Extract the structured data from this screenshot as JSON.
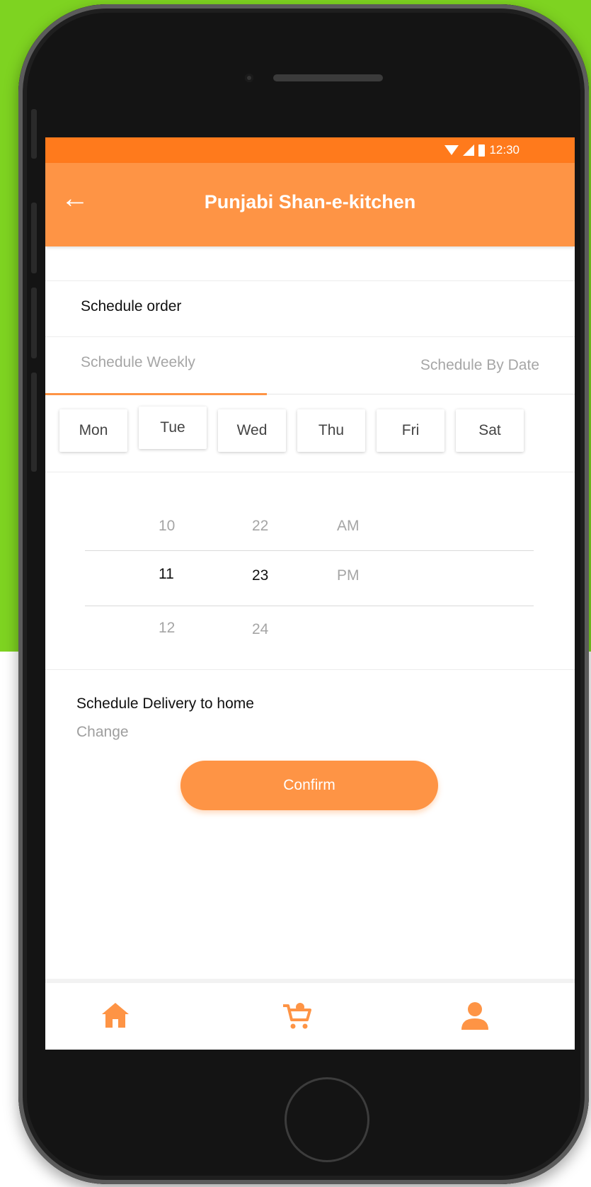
{
  "status_bar": {
    "time": "12:30"
  },
  "app_bar": {
    "title": "Punjabi Shan-e-kitchen",
    "back_icon": "back-arrow-icon"
  },
  "schedule": {
    "label": "Schedule order",
    "tabs": [
      {
        "label": "Schedule Weekly",
        "active": true
      },
      {
        "label": "Schedule By Date",
        "active": false
      }
    ],
    "days": [
      "Mon",
      "Tue",
      "Wed",
      "Thu",
      "Fri",
      "Sat"
    ]
  },
  "time_picker": {
    "hours": [
      "10",
      "11",
      "12"
    ],
    "minutes": [
      "22",
      "23",
      "24"
    ],
    "periods": [
      "AM",
      "PM"
    ]
  },
  "delivery": {
    "text": "Schedule Delivery to home",
    "change_label": "Change",
    "confirm_label": "Confirm"
  },
  "bottom_nav": {
    "icons": [
      "home-icon",
      "cart-icon",
      "profile-icon"
    ]
  },
  "colors": {
    "accent": "#fe9445",
    "status_bar": "#ff7a1c",
    "background": "#7ed321"
  }
}
